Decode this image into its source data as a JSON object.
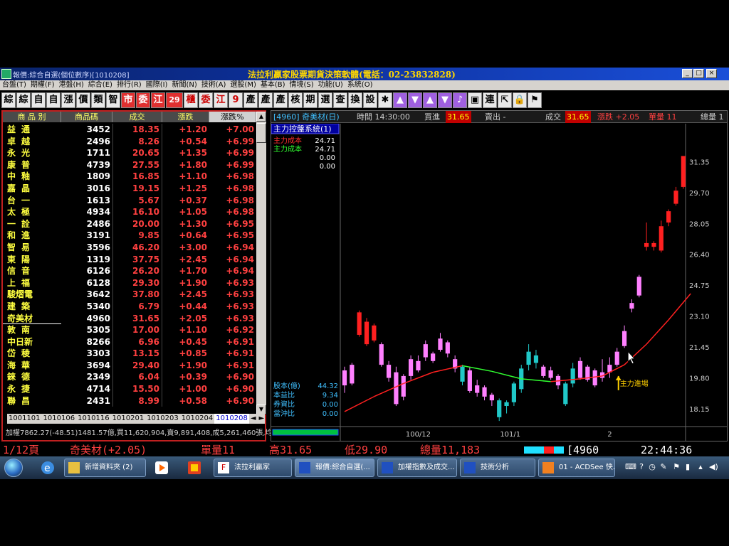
{
  "window": {
    "title": "報價:綜合自選(個位數序)[1010208]",
    "ad_text": "法拉利贏家股票期貨決策軟體(電話：02-23832828)"
  },
  "menu": [
    "台盤(T)",
    "期權(F)",
    "港盤(H)",
    "綜合(E)",
    "排行(R)",
    "國際(I)",
    "新聞(N)",
    "技術(A)",
    "選股(M)",
    "基本(B)",
    "情境(S)",
    "功能(U)",
    "系統(O)"
  ],
  "toolbar": [
    "綜",
    "綜",
    "自",
    "自",
    "漲",
    "價",
    "類",
    "智",
    "市",
    "委",
    "江",
    "29",
    "櫃",
    "委",
    "江",
    "9",
    "產",
    "產",
    "產",
    "核",
    "期",
    "選",
    "查",
    "換",
    "設"
  ],
  "quote_table": {
    "headers": [
      "商 品 別",
      "商品碼",
      "成交",
      "漲跌",
      "漲跌%"
    ],
    "rows": [
      {
        "name": "益通",
        "code": "3452",
        "price": "18.35",
        "change": "+1.20",
        "pct": "+7.00"
      },
      {
        "name": "卓越",
        "code": "2496",
        "price": "8.26",
        "change": "+0.54",
        "pct": "+6.99"
      },
      {
        "name": "永光",
        "code": "1711",
        "price": "20.65",
        "change": "+1.35",
        "pct": "+6.99"
      },
      {
        "name": "康普",
        "code": "4739",
        "price": "27.55",
        "change": "+1.80",
        "pct": "+6.99"
      },
      {
        "name": "中釉",
        "code": "1809",
        "price": "16.85",
        "change": "+1.10",
        "pct": "+6.98"
      },
      {
        "name": "嘉晶",
        "code": "3016",
        "price": "19.15",
        "change": "+1.25",
        "pct": "+6.98"
      },
      {
        "name": "台一",
        "code": "1613",
        "price": "5.67",
        "change": "+0.37",
        "pct": "+6.98"
      },
      {
        "name": "太極",
        "code": "4934",
        "price": "16.10",
        "change": "+1.05",
        "pct": "+6.98"
      },
      {
        "name": "一詮",
        "code": "2486",
        "price": "20.00",
        "change": "+1.30",
        "pct": "+6.95"
      },
      {
        "name": "和進",
        "code": "3191",
        "price": "9.85",
        "change": "+0.64",
        "pct": "+6.95"
      },
      {
        "name": "智易",
        "code": "3596",
        "price": "46.20",
        "change": "+3.00",
        "pct": "+6.94"
      },
      {
        "name": "東陽",
        "code": "1319",
        "price": "37.75",
        "change": "+2.45",
        "pct": "+6.94"
      },
      {
        "name": "信音",
        "code": "6126",
        "price": "26.20",
        "change": "+1.70",
        "pct": "+6.94"
      },
      {
        "name": "上福",
        "code": "6128",
        "price": "29.30",
        "change": "+1.90",
        "pct": "+6.93"
      },
      {
        "name": "駿熠電",
        "code": "3642",
        "price": "37.80",
        "change": "+2.45",
        "pct": "+6.93"
      },
      {
        "name": "建築",
        "code": "5340",
        "price": "6.79",
        "change": "+0.44",
        "pct": "+6.93"
      },
      {
        "name": "奇美材",
        "code": "4960",
        "price": "31.65",
        "change": "+2.05",
        "pct": "+6.93"
      },
      {
        "name": "敦南",
        "code": "5305",
        "price": "17.00",
        "change": "+1.10",
        "pct": "+6.92"
      },
      {
        "name": "中日新",
        "code": "8266",
        "price": "6.96",
        "change": "+0.45",
        "pct": "+6.91"
      },
      {
        "name": "岱稜",
        "code": "3303",
        "price": "13.15",
        "change": "+0.85",
        "pct": "+6.91"
      },
      {
        "name": "海華",
        "code": "3694",
        "price": "29.40",
        "change": "+1.90",
        "pct": "+6.91"
      },
      {
        "name": "錸德",
        "code": "2349",
        "price": "6.04",
        "change": "+0.39",
        "pct": "+6.90"
      },
      {
        "name": "永捷",
        "code": "4714",
        "price": "15.50",
        "change": "+1.00",
        "pct": "+6.90"
      },
      {
        "name": "聯昌",
        "code": "2431",
        "price": "8.99",
        "change": "+0.58",
        "pct": "+6.90"
      }
    ]
  },
  "tabs": [
    "1001101",
    "1010106",
    "1010116",
    "1010201",
    "1010203",
    "1010204",
    "1010208"
  ],
  "tab_arrows": {
    "left": "◄",
    "right": "►"
  },
  "index_line": "加權7862.27(-48.51)1481.57億,買11,620,904,賣9,891,408,成5,261,460張,均張4.3",
  "chart_header": {
    "stock": "[4960] 奇美材(日)",
    "time": "時間 14:30:00",
    "buy_label": "買進",
    "buy": "31.65",
    "sell": "賣出 -",
    "deal_label": "成交",
    "deal": "31.65",
    "change": "漲跌 +2.05",
    "vol": "單量 11",
    "total": "總量 1"
  },
  "chart_panel": {
    "system_label": "主力控盤系統(1)",
    "legend": [
      {
        "label": "主力成本",
        "value": "24.71",
        "color": "#ff3030"
      },
      {
        "label": "主力成本",
        "value": "24.71",
        "color": "#30ff30"
      },
      {
        "label": "",
        "value": "0.00",
        "color": "#ffffff"
      },
      {
        "label": "",
        "value": "0.00",
        "color": "#ffffff"
      }
    ],
    "annotation": "主力進場",
    "fundamentals": [
      {
        "label": "股本(億)",
        "value": "44.32"
      },
      {
        "label": "本益比",
        "value": "9.34"
      },
      {
        "label": "券資比",
        "value": "0.00"
      },
      {
        "label": "當沖比",
        "value": "0.00"
      }
    ],
    "x_labels": [
      "100/12",
      "101/1",
      "2"
    ]
  },
  "chart_data": {
    "type": "candlestick",
    "y_ticks": [
      31.35,
      29.7,
      28.05,
      26.4,
      24.75,
      23.1,
      21.45,
      19.8,
      18.15
    ],
    "ylim": [
      17.2,
      33.3
    ],
    "candles": [
      {
        "o": 20.2,
        "h": 20.4,
        "l": 19.0,
        "c": 19.4,
        "color": "#ff80ff"
      },
      {
        "o": 20.5,
        "h": 20.6,
        "l": 19.4,
        "c": 19.5,
        "color": "#ff80ff"
      },
      {
        "o": 23.3,
        "h": 23.4,
        "l": 22.0,
        "c": 22.1,
        "color": "#ff2020"
      },
      {
        "o": 22.8,
        "h": 23.0,
        "l": 21.5,
        "c": 21.6,
        "color": "#ff2020"
      },
      {
        "o": 22.6,
        "h": 22.7,
        "l": 21.7,
        "c": 21.8,
        "color": "#ff2020"
      },
      {
        "o": 21.6,
        "h": 21.7,
        "l": 20.4,
        "c": 20.5,
        "color": "#ff80ff"
      },
      {
        "o": 20.5,
        "h": 20.7,
        "l": 19.6,
        "c": 19.8,
        "color": "#ff80ff"
      },
      {
        "o": 20.1,
        "h": 20.4,
        "l": 18.3,
        "c": 18.4,
        "color": "#ff80ff"
      },
      {
        "o": 19.9,
        "h": 20.0,
        "l": 18.6,
        "c": 18.8,
        "color": "#ff80ff"
      },
      {
        "o": 20.8,
        "h": 21.0,
        "l": 19.7,
        "c": 19.9,
        "color": "#ff80ff"
      },
      {
        "o": 20.7,
        "h": 21.0,
        "l": 20.1,
        "c": 20.2,
        "color": "#ff80ff"
      },
      {
        "o": 21.6,
        "h": 21.8,
        "l": 20.7,
        "c": 20.9,
        "color": "#ff80ff"
      },
      {
        "o": 21.1,
        "h": 21.2,
        "l": 20.6,
        "c": 20.7,
        "color": "#ff80ff"
      },
      {
        "o": 21.9,
        "h": 22.2,
        "l": 21.2,
        "c": 21.3,
        "color": "#ff80ff"
      },
      {
        "o": 21.7,
        "h": 21.8,
        "l": 20.9,
        "c": 21.1,
        "color": "#ff80ff"
      },
      {
        "o": 20.8,
        "h": 21.0,
        "l": 20.1,
        "c": 20.3,
        "color": "#ff80ff"
      },
      {
        "o": 19.6,
        "h": 20.5,
        "l": 19.4,
        "c": 20.4,
        "color": "#20c8c8"
      },
      {
        "o": 20.2,
        "h": 20.4,
        "l": 19.0,
        "c": 19.1,
        "color": "#ff80ff"
      },
      {
        "o": 19.4,
        "h": 19.7,
        "l": 18.8,
        "c": 19.0,
        "color": "#ff80ff"
      },
      {
        "o": 19.3,
        "h": 19.4,
        "l": 18.6,
        "c": 18.8,
        "color": "#ff80ff"
      },
      {
        "o": 18.9,
        "h": 19.0,
        "l": 18.3,
        "c": 18.6,
        "color": "#ff80ff"
      },
      {
        "o": 17.7,
        "h": 18.7,
        "l": 17.5,
        "c": 18.6,
        "color": "#20c8c8"
      },
      {
        "o": 18.3,
        "h": 18.6,
        "l": 17.9,
        "c": 18.5,
        "color": "#20c8c8"
      },
      {
        "o": 18.5,
        "h": 19.6,
        "l": 18.3,
        "c": 19.5,
        "color": "#20c8c8"
      },
      {
        "o": 19.2,
        "h": 20.5,
        "l": 19.0,
        "c": 20.3,
        "color": "#20c8c8"
      },
      {
        "o": 20.5,
        "h": 21.6,
        "l": 20.2,
        "c": 21.2,
        "color": "#20c8c8"
      },
      {
        "o": 20.6,
        "h": 21.3,
        "l": 20.3,
        "c": 21.0,
        "color": "#20c8c8"
      },
      {
        "o": 20.4,
        "h": 20.5,
        "l": 19.8,
        "c": 19.9,
        "color": "#ff80ff"
      },
      {
        "o": 20.2,
        "h": 20.4,
        "l": 19.7,
        "c": 19.8,
        "color": "#ff80ff"
      },
      {
        "o": 19.9,
        "h": 20.0,
        "l": 19.2,
        "c": 19.4,
        "color": "#ff80ff"
      },
      {
        "o": 18.4,
        "h": 19.6,
        "l": 18.3,
        "c": 19.5,
        "color": "#20c8c8"
      },
      {
        "o": 19.5,
        "h": 20.6,
        "l": 19.3,
        "c": 20.3,
        "color": "#20c8c8"
      },
      {
        "o": 20.7,
        "h": 20.9,
        "l": 19.7,
        "c": 19.8,
        "color": "#ff80ff"
      },
      {
        "o": 20.4,
        "h": 20.5,
        "l": 19.6,
        "c": 19.7,
        "color": "#ff80ff"
      },
      {
        "o": 20.2,
        "h": 20.3,
        "l": 19.3,
        "c": 19.4,
        "color": "#ff80ff"
      },
      {
        "o": 20.1,
        "h": 20.8,
        "l": 19.6,
        "c": 19.8,
        "color": "#ff80ff"
      },
      {
        "o": 20.5,
        "h": 20.9,
        "l": 19.8,
        "c": 20.1,
        "color": "#ff80ff"
      },
      {
        "o": 21.2,
        "h": 21.4,
        "l": 20.4,
        "c": 20.5,
        "color": "#ff80ff"
      },
      {
        "o": 22.3,
        "h": 22.6,
        "l": 21.4,
        "c": 21.5,
        "color": "#ff80ff"
      },
      {
        "o": 23.8,
        "h": 24.0,
        "l": 23.3,
        "c": 23.5,
        "color": "#ff80ff"
      },
      {
        "o": 25.2,
        "h": 25.3,
        "l": 24.1,
        "c": 24.2,
        "color": "#ff80ff"
      },
      {
        "o": 27.0,
        "h": 28.1,
        "l": 26.6,
        "c": 26.8,
        "color": "#ff2020"
      },
      {
        "o": 27.0,
        "h": 27.1,
        "l": 26.6,
        "c": 26.8,
        "color": "#ff2020"
      },
      {
        "o": 27.9,
        "h": 28.2,
        "l": 26.5,
        "c": 26.6,
        "color": "#ff2020"
      },
      {
        "o": 28.7,
        "h": 28.8,
        "l": 27.9,
        "c": 28.1,
        "color": "#ff2020"
      },
      {
        "o": 29.8,
        "h": 30.0,
        "l": 29.0,
        "c": 29.1,
        "color": "#ff2020"
      },
      {
        "o": 31.65,
        "h": 31.65,
        "l": 29.9,
        "c": 30.0,
        "color": "#ff2020"
      }
    ],
    "ma_line": [
      {
        "i": 0,
        "v": 18.0
      },
      {
        "i": 4,
        "v": 18.8
      },
      {
        "i": 8,
        "v": 19.5
      },
      {
        "i": 12,
        "v": 20.1
      },
      {
        "i": 16,
        "v": 20.45
      },
      {
        "i": 20,
        "v": 20.15
      },
      {
        "i": 24,
        "v": 19.75
      },
      {
        "i": 28,
        "v": 19.6
      },
      {
        "i": 32,
        "v": 19.75
      },
      {
        "i": 35,
        "v": 19.9
      },
      {
        "i": 38,
        "v": 20.5
      },
      {
        "i": 41,
        "v": 21.6
      },
      {
        "i": 44,
        "v": 22.9
      },
      {
        "i": 47,
        "v": 24.3
      }
    ],
    "ma_green_range": [
      16,
      28
    ]
  },
  "ticker": {
    "page": "1/12頁",
    "name": "奇美材(+2.05)",
    "vol": "單量11",
    "high": "高31.65",
    "low": "低29.90",
    "total": "總量11,183",
    "code": "[4960",
    "clock": "22:44:36"
  },
  "taskbar": {
    "tasks": [
      "新增資料夾 (2)",
      "法拉利贏家",
      "報價:綜合自選(...",
      "加權指數及成交...",
      "技術分析",
      "01 - ACDSee 快..."
    ]
  }
}
